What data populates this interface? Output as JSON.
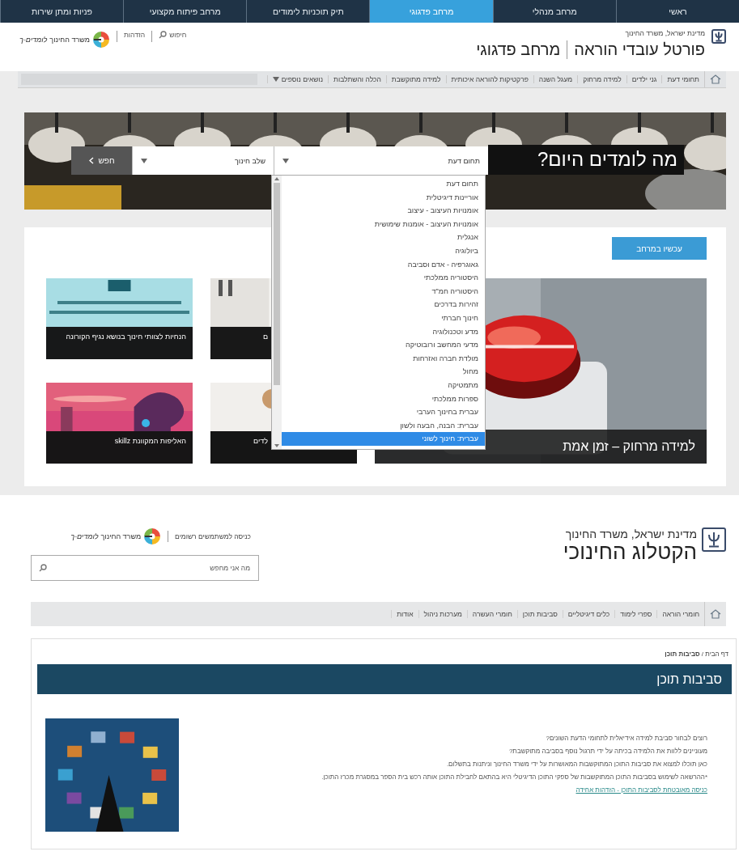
{
  "portal": {
    "top_nav": [
      {
        "label": "ראשי",
        "selected": false
      },
      {
        "label": "מרחב מנהלי",
        "selected": false
      },
      {
        "label": "מרחב פדגוגי",
        "selected": true
      },
      {
        "label": "תיק תוכניות לימודים",
        "selected": false
      },
      {
        "label": "מרחב פיתוח מקצועי",
        "selected": false
      },
      {
        "label": "פניות ומתן שירות",
        "selected": false
      }
    ],
    "header": {
      "ministry": "מדינת ישראל, משרד החינוך",
      "title": "פורטל עובדי הוראה",
      "subtitle": "מרחב פדגוגי",
      "search": "חיפוש",
      "login": "הזדהות",
      "logo_text": "משרד החינוך",
      "logo_tagline": "לומדים-ך"
    },
    "nav": [
      "תחומי דעת",
      "גני ילדים",
      "למידה מרחוק",
      "מעגל השנה",
      "פרקטיקות להוראה איכותית",
      "למידה מתוקשבת",
      "הכלה והשתלבות",
      "נושאים נוספים"
    ],
    "banner": {
      "heading": "מה לומדים היום?",
      "subject_select": "תחום דעת",
      "stage_select": "שלב חינוך",
      "search_button": "חפש"
    },
    "subject_options": [
      {
        "label": "תחום דעת",
        "selected": false
      },
      {
        "label": "אוריינות דיגיטלית",
        "selected": false
      },
      {
        "label": "אומנויות העיצוב - עיצוב",
        "selected": false
      },
      {
        "label": "אומנויות העיצוב - אומנות שימושית",
        "selected": false
      },
      {
        "label": "אנגלית",
        "selected": false
      },
      {
        "label": "ביולוגיה",
        "selected": false
      },
      {
        "label": "גאוגרפיה - אדם וסביבה",
        "selected": false
      },
      {
        "label": "היסטוריה ממלכתי",
        "selected": false
      },
      {
        "label": "היסטוריה חמ\"ד",
        "selected": false
      },
      {
        "label": "זהירות בדרכים",
        "selected": false
      },
      {
        "label": "חינוך חברתי",
        "selected": false
      },
      {
        "label": "מדע וטכנולוגיה",
        "selected": false
      },
      {
        "label": "מדעי המחשב ורובוטיקה",
        "selected": false
      },
      {
        "label": "מולדת חברה ואזרחות",
        "selected": false
      },
      {
        "label": "מחול",
        "selected": false
      },
      {
        "label": "מתמטיקה",
        "selected": false
      },
      {
        "label": "ספרות ממלכתי",
        "selected": false
      },
      {
        "label": "עברית בחינוך הערבי",
        "selected": false
      },
      {
        "label": "עברית: הבנה, הבעה ולשון",
        "selected": false
      },
      {
        "label": "עברית: חינוך לשוני",
        "selected": true
      }
    ],
    "now_button": "עכשיו במרחב",
    "tiles": [
      {
        "kind": "large",
        "caption": "למידה מרחוק – זמן אמת"
      },
      {
        "kind": "partial",
        "caption": "ם"
      },
      {
        "kind": "partial",
        "caption": "לדים"
      },
      {
        "kind": "small",
        "caption": "הנחיות לצוותי חינוך בנושא נגיף הקורונה"
      },
      {
        "kind": "small",
        "caption": "האליפות המקוונת skillz"
      }
    ]
  },
  "catalog": {
    "header": {
      "ministry": "מדינת ישראל, משרד החינוך",
      "title": "הקטלוג החינוכי",
      "login": "כניסה למשתמשים רשומים",
      "logo_text": "משרד החינוך",
      "logo_tagline": "לומדים-ך"
    },
    "search": {
      "placeholder": "מה אני מחפש"
    },
    "nav": [
      "חומרי הוראה",
      "ספרי לימוד",
      "כלים דיגיטליים",
      "סביבות תוכן",
      "חומרי העשרה",
      "מערכות ניהול",
      "אודות"
    ],
    "breadcrumb": "דף הבית / **סביבות תוכן**",
    "page_title": "סביבות תוכן",
    "paragraphs": [
      "רוצים לבחור סביבת למידה אידיאלית לתחומי הדעת השונים?",
      "מעוניינים ללוות את הלמידה בכיתה על ידי תרגול נוסף בסביבה מתוקשבת?",
      "כאן תוכלו למצוא את סביבות התוכן המתוקשבות המאושרות על ידי משרד החינוך וניתנות בתשלום.",
      "*ההרשאה לשימוש בסביבות התוכן המתוקשבות של ספקי התוכן הדיגיטלי היא בהתאם לחבילת התוכן אותה רכש בית הספר במסגרת מכרז התוכן."
    ],
    "link": "כניסה מאובטחת לסביבות התוכן - הזדהות אחידה"
  }
}
